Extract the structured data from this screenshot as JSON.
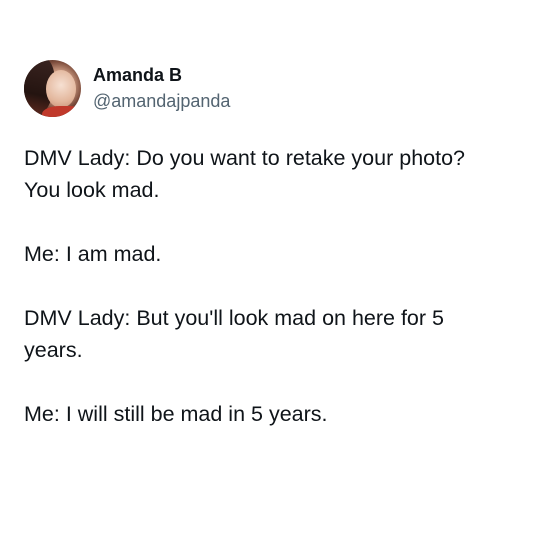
{
  "author": {
    "display_name": "Amanda B",
    "handle": "@amandajpanda"
  },
  "tweet": {
    "lines": [
      "DMV Lady: Do you want to retake your photo?",
      "You look mad.",
      "Me: I am mad.",
      "DMV Lady: But you'll look mad on here for 5",
      "years.",
      "Me: I will still be mad in 5 years."
    ]
  },
  "colors": {
    "text": "#0f1419",
    "handle": "#536471",
    "background": "#ffffff"
  }
}
